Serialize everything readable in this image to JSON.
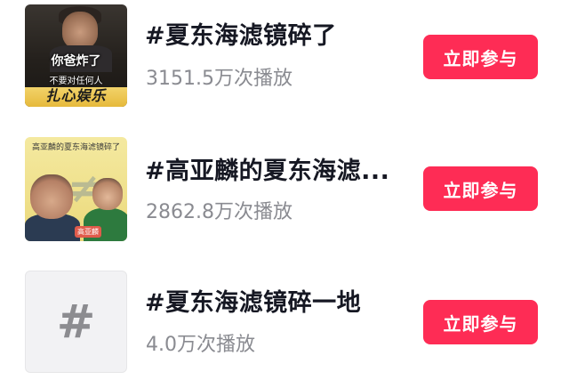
{
  "topics": [
    {
      "title": "#夏东海滤镜碎了",
      "plays": "3151.5万次播放",
      "button_label": "立即参与",
      "thumbnail": {
        "caption": "你爸炸了",
        "subcaption": "不要对任何人",
        "logo": "扎心娱乐"
      }
    },
    {
      "title": "#高亚麟的夏东海滤...",
      "plays": "2862.8万次播放",
      "button_label": "立即参与",
      "thumbnail": {
        "banner": "高亚麟的夏东海滤镜碎了",
        "tag": "高亚麟"
      }
    },
    {
      "title": "#夏东海滤镜碎一地",
      "plays": "4.0万次播放",
      "button_label": "立即参与",
      "thumbnail": {
        "icon": "hashtag-icon",
        "glyph": "#"
      }
    }
  ],
  "colors": {
    "accent": "#fe2c55",
    "title": "#161823",
    "secondary": "#8a8b91"
  }
}
